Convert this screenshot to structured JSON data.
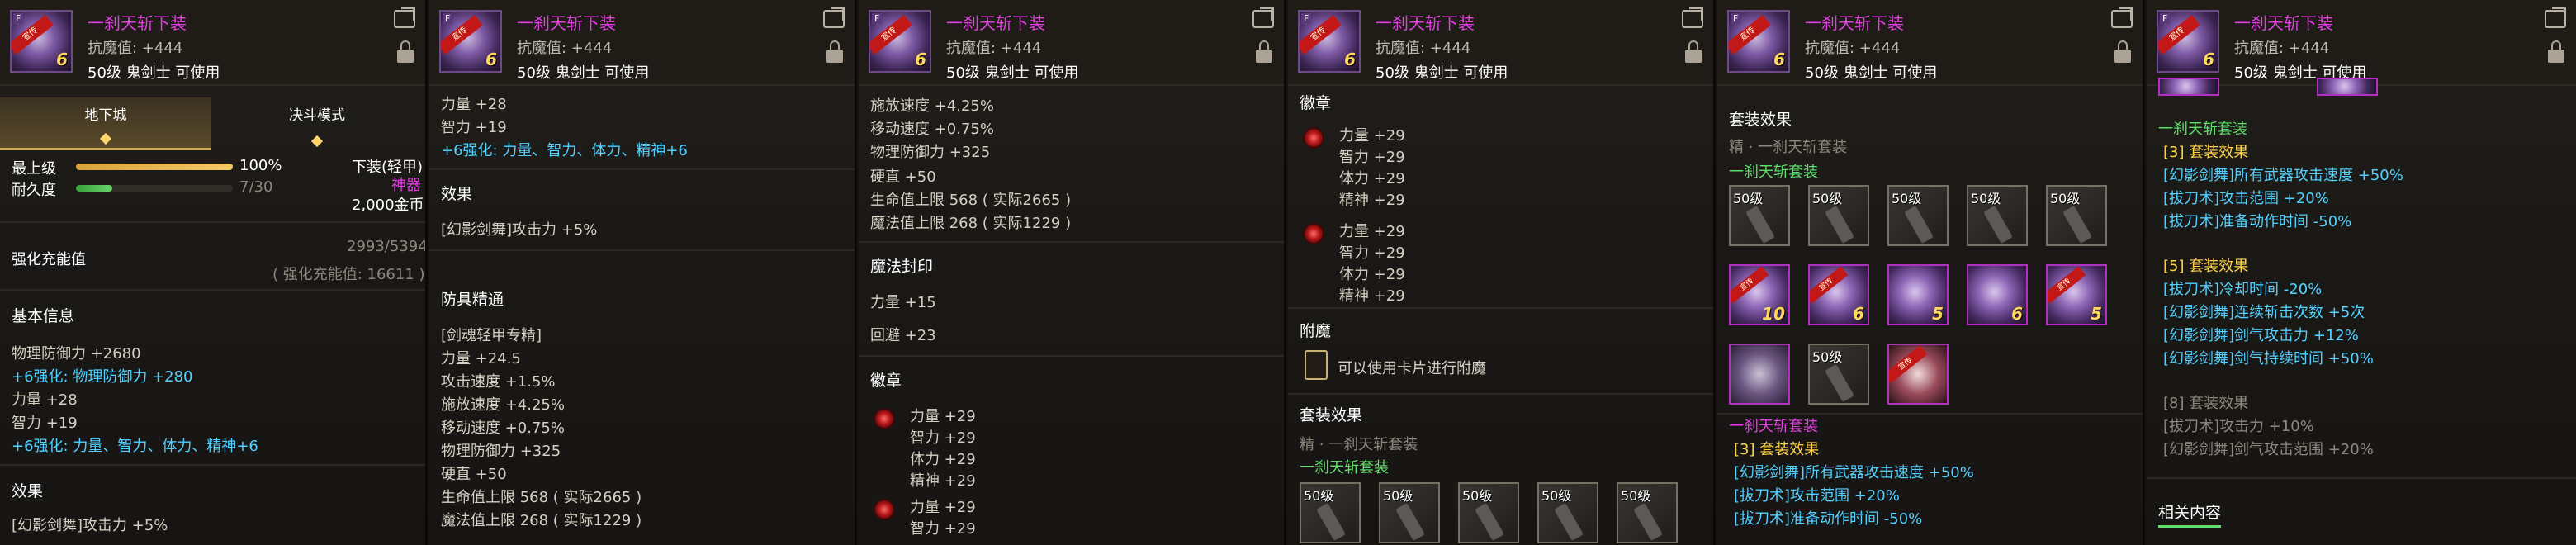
{
  "item": {
    "name": "一刹天斩下装",
    "resist": "抗魔值: +444",
    "level_class": "50级 鬼剑士 可使用",
    "thumb_tag": "F",
    "thumb_num": "6",
    "ribbon_text": "宣传"
  },
  "p1": {
    "tabs": [
      "地下城",
      "决斗模式"
    ],
    "active_tab": "地下城",
    "max_level_label": "最上级",
    "max_level_pct": "100%",
    "max_level_fill": 1.0,
    "durability_label": "耐久度",
    "durability_value": "7/30",
    "durability_fill": 0.233,
    "type_label": "下装(轻甲)",
    "rarity": "神器",
    "price": "2,000金币",
    "reinforce_label": "强化充能值",
    "reinforce_value": "2993/5394",
    "reinforce_note": "( 强化充能值: 16611 )",
    "basic_title": "基本信息",
    "basic_lines": [
      "物理防御力 +2680"
    ],
    "basic_cyan": "+6强化: 物理防御力 +280",
    "stat_lines": [
      "力量 +28",
      "智力 +19"
    ],
    "stat_cyan": "+6强化: 力量、智力、体力、精神+6",
    "effect_title": "效果",
    "effect_line": "[幻影剑舞]攻击力 +5%"
  },
  "p2": {
    "top_lines": [
      "力量 +28",
      "智力 +19"
    ],
    "top_cyan": "+6强化: 力量、智力、体力、精神+6",
    "effect_title": "效果",
    "effect_line": "[幻影剑舞]攻击力 +5%",
    "mastery_title": "防具精通",
    "mastery_lines": [
      "[剑魂轻甲专精]",
      "力量 +24.5",
      "攻击速度 +1.5%",
      "施放速度 +4.25%",
      "移动速度 +0.75%",
      "物理防御力 +325",
      "硬直 +50",
      "生命值上限 568 ( 实际2665 )",
      "魔法值上限 268 ( 实际1229 )"
    ]
  },
  "p3": {
    "top_lines": [
      "施放速度 +4.25%",
      "移动速度 +0.75%",
      "物理防御力 +325",
      "硬直 +50",
      "生命值上限 568 ( 实际2665 )",
      "魔法值上限 268 ( 实际1229 )"
    ],
    "seal_title": "魔法封印",
    "seal_lines": [
      "力量 +15",
      "回避 +23"
    ],
    "emblem_title": "徽章",
    "emblem_lines": [
      "力量 +29",
      "智力 +29",
      "体力 +29",
      "精神 +29"
    ],
    "emblem2_lines": [
      "力量 +29",
      "智力 +29"
    ]
  },
  "p4": {
    "emblem_title": "徽章",
    "emblem_lines": [
      "力量 +29",
      "智力 +29",
      "体力 +29",
      "精神 +29"
    ],
    "enchant_title": "附魔",
    "enchant_text": "可以使用卡片进行附魔",
    "set_title": "套装效果",
    "set_sub": "精 · 一刹天斩套装",
    "set_name": "一刹天斩套装",
    "slot_label": "50级"
  },
  "p5": {
    "set_title": "套装效果",
    "set_sub": "精 · 一刹天斩套装",
    "set_name": "一刹天斩套装",
    "slot_label": "50级",
    "row2_nums": [
      "10",
      "6",
      "5",
      "6",
      "5"
    ],
    "set_name2": "一刹天斩套装",
    "bonus3_title": "[3] 套装效果",
    "bonus3_lines": [
      "[幻影剑舞]所有武器攻击速度 +50%",
      "[拔刀术]攻击范围 +20%",
      "[拔刀术]准备动作时间 -50%"
    ]
  },
  "p6": {
    "set_name": "一刹天斩套装",
    "bonus3_title": "[3] 套装效果",
    "bonus3_lines": [
      "[幻影剑舞]所有武器攻击速度 +50%",
      "[拔刀术]攻击范围 +20%",
      "[拔刀术]准备动作时间 -50%"
    ],
    "bonus5_title": "[5] 套装效果",
    "bonus5_lines": [
      "[拔刀术]冷却时间 -20%",
      "[幻影剑舞]连续斩击次数 +5次",
      "[幻影剑舞]剑气攻击力 +12%",
      "[幻影剑舞]剑气持续时间 +50%"
    ],
    "bonus8_title": "[8] 套装效果",
    "bonus8_lines": [
      "[拔刀术]攻击力 +10%",
      "[幻影剑舞]剑气攻击范围 +20%"
    ],
    "related_title": "相关内容"
  }
}
